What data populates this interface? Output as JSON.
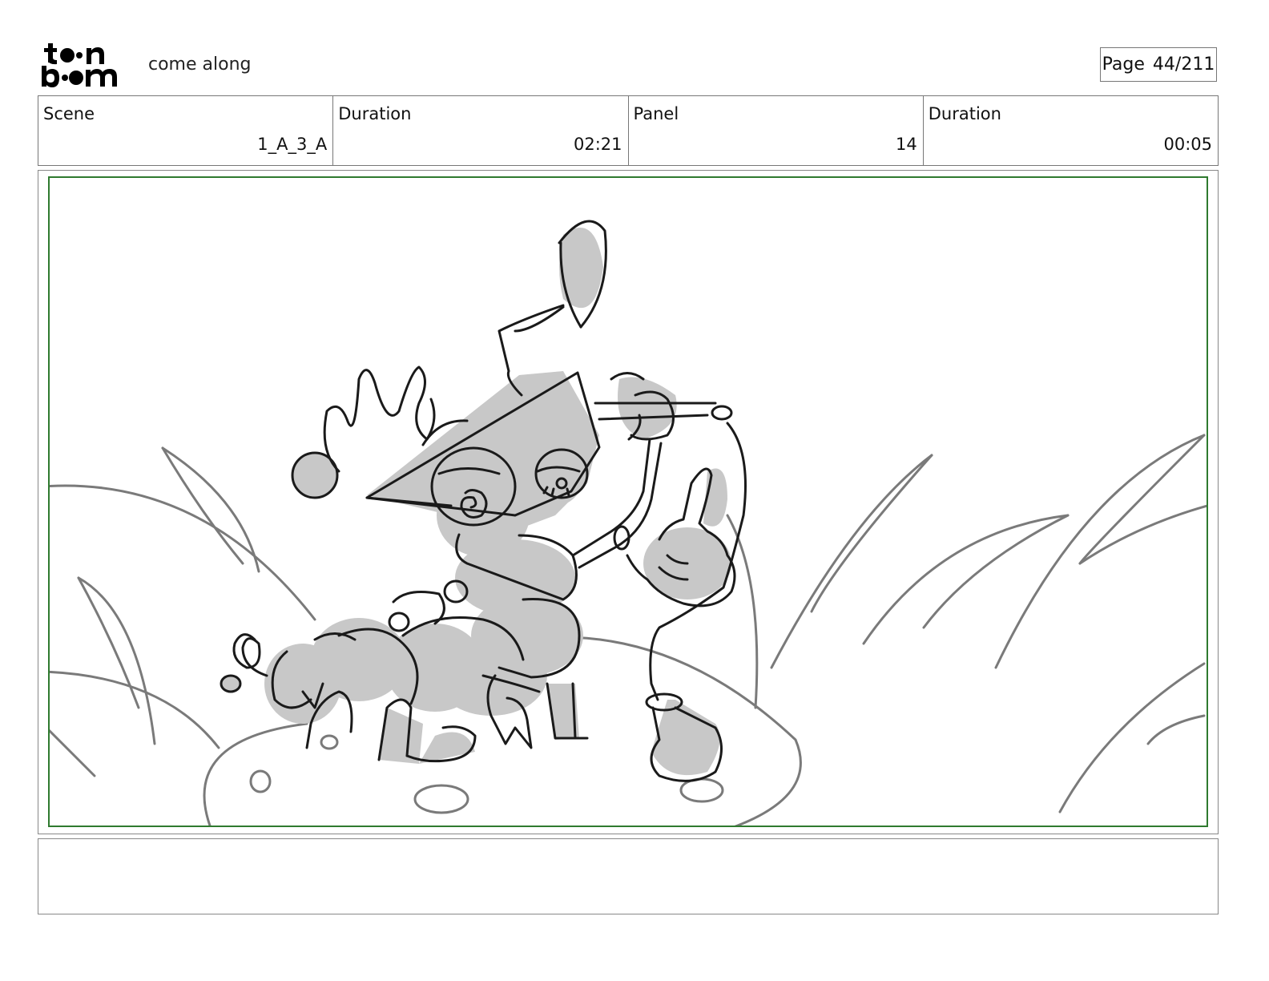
{
  "header": {
    "logo_name": "toon boom",
    "project_title": "come along",
    "page_label": "Page",
    "page_value": "44/211"
  },
  "info": [
    {
      "label": "Scene",
      "value": "1_A_3_A"
    },
    {
      "label": "Duration",
      "value": "02:21"
    },
    {
      "label": "Panel",
      "value": "14"
    },
    {
      "label": "Duration",
      "value": "00:05"
    }
  ],
  "panel": {
    "frame_color": "#2f7a2f",
    "sketch_fill": "#c8c8c8",
    "sketch_line": "#1a1a1a",
    "background_line": "#7a7a7a"
  },
  "notes": {
    "text": ""
  }
}
